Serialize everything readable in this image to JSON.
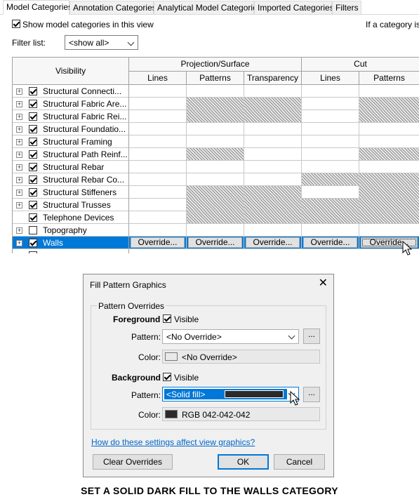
{
  "tabs": [
    "Model Categories",
    "Annotation Categories",
    "Analytical Model Categories",
    "Imported Categories",
    "Filters"
  ],
  "show_model_categories": {
    "label": "Show model categories in this view",
    "checked": true
  },
  "if_category_text": "If a category is",
  "filter": {
    "label": "Filter list:",
    "value": "<show all>"
  },
  "grid": {
    "visibility_header": "Visibility",
    "projection_header": "Projection/Surface",
    "cut_header": "Cut",
    "sub_headers": [
      "Lines",
      "Patterns",
      "Transparency",
      "Lines",
      "Patterns"
    ],
    "rows": [
      {
        "name": "Structural Connecti...",
        "expandable": true,
        "checked": true,
        "hatch": [
          false,
          false,
          false,
          false,
          false
        ]
      },
      {
        "name": "Structural Fabric Are...",
        "expandable": true,
        "checked": true,
        "hatch": [
          false,
          true,
          true,
          false,
          true
        ]
      },
      {
        "name": "Structural Fabric Rei...",
        "expandable": true,
        "checked": true,
        "hatch": [
          false,
          true,
          true,
          false,
          true
        ]
      },
      {
        "name": "Structural Foundatio...",
        "expandable": true,
        "checked": true,
        "hatch": [
          false,
          false,
          false,
          false,
          false
        ]
      },
      {
        "name": "Structural Framing",
        "expandable": true,
        "checked": true,
        "hatch": [
          false,
          false,
          false,
          false,
          false
        ]
      },
      {
        "name": "Structural Path Reinf...",
        "expandable": true,
        "checked": true,
        "hatch": [
          false,
          true,
          false,
          false,
          true
        ]
      },
      {
        "name": "Structural Rebar",
        "expandable": true,
        "checked": true,
        "hatch": [
          false,
          false,
          false,
          false,
          false
        ]
      },
      {
        "name": "Structural Rebar Co...",
        "expandable": true,
        "checked": true,
        "hatch": [
          false,
          false,
          false,
          true,
          true
        ]
      },
      {
        "name": "Structural Stiffeners",
        "expandable": true,
        "checked": true,
        "hatch": [
          false,
          true,
          true,
          false,
          true
        ]
      },
      {
        "name": "Structural Trusses",
        "expandable": true,
        "checked": true,
        "hatch": [
          false,
          true,
          true,
          true,
          true
        ]
      },
      {
        "name": "Telephone Devices",
        "expandable": false,
        "checked": true,
        "hatch": [
          false,
          true,
          true,
          true,
          true
        ]
      },
      {
        "name": "Topography",
        "expandable": true,
        "checked": false,
        "hatch": [
          false,
          false,
          false,
          false,
          false
        ]
      }
    ],
    "selected_row": {
      "name": "Walls",
      "checked": true,
      "override_label": "Override..."
    }
  },
  "dialog": {
    "title": "Fill Pattern Graphics",
    "group_title": "Pattern Overrides",
    "foreground": {
      "heading": "Foreground",
      "visible_label": "Visible",
      "visible": true,
      "pattern_label": "Pattern:",
      "pattern_value": "<No Override>",
      "color_label": "Color:",
      "color_value": "<No Override>",
      "color_swatch": "#e9e9e9",
      "browse_label": "..."
    },
    "background": {
      "heading": "Background",
      "visible_label": "Visible",
      "visible": true,
      "pattern_label": "Pattern:",
      "pattern_value": "<Solid fill>",
      "color_label": "Color:",
      "color_value": "RGB 042-042-042",
      "color_swatch": "#2a2a2a",
      "browse_label": "..."
    },
    "help_link": "How do these settings affect view graphics?",
    "clear_button": "Clear Overrides",
    "ok_button": "OK",
    "cancel_button": "Cancel"
  },
  "caption": "SET A SOLID DARK FILL TO THE WALLS CATEGORY",
  "colors": {
    "selection": "#0078d7",
    "link": "#0066cc"
  }
}
